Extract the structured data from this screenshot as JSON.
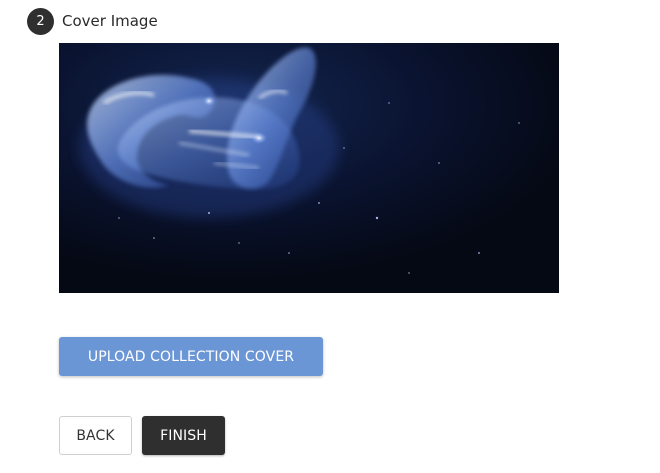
{
  "step": {
    "number": "2",
    "title": "Cover Image"
  },
  "cover_image": {
    "icon": "cover-image-jellyfish",
    "background_color": "#070c1d"
  },
  "upload": {
    "label": "UPLOAD COLLECTION COVER",
    "color": "#6b96d6"
  },
  "nav": {
    "back_label": "BACK",
    "finish_label": "FINISH",
    "finish_color": "#2f2f2f"
  }
}
